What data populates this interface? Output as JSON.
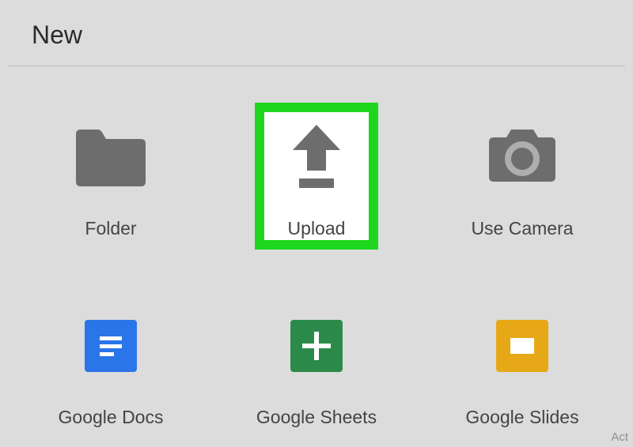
{
  "header": {
    "title": "New"
  },
  "options": {
    "folder": {
      "label": "Folder"
    },
    "upload": {
      "label": "Upload"
    },
    "use_camera": {
      "label": "Use Camera"
    },
    "google_docs": {
      "label": "Google Docs"
    },
    "google_sheets": {
      "label": "Google Sheets"
    },
    "google_slides": {
      "label": "Google Slides"
    }
  },
  "watermark": "Act",
  "colors": {
    "highlight": "#1fd61f",
    "docs": "#2a75e8",
    "sheets": "#2b8a4a",
    "slides": "#e6a817",
    "icon_gray": "#6d6d6d"
  }
}
